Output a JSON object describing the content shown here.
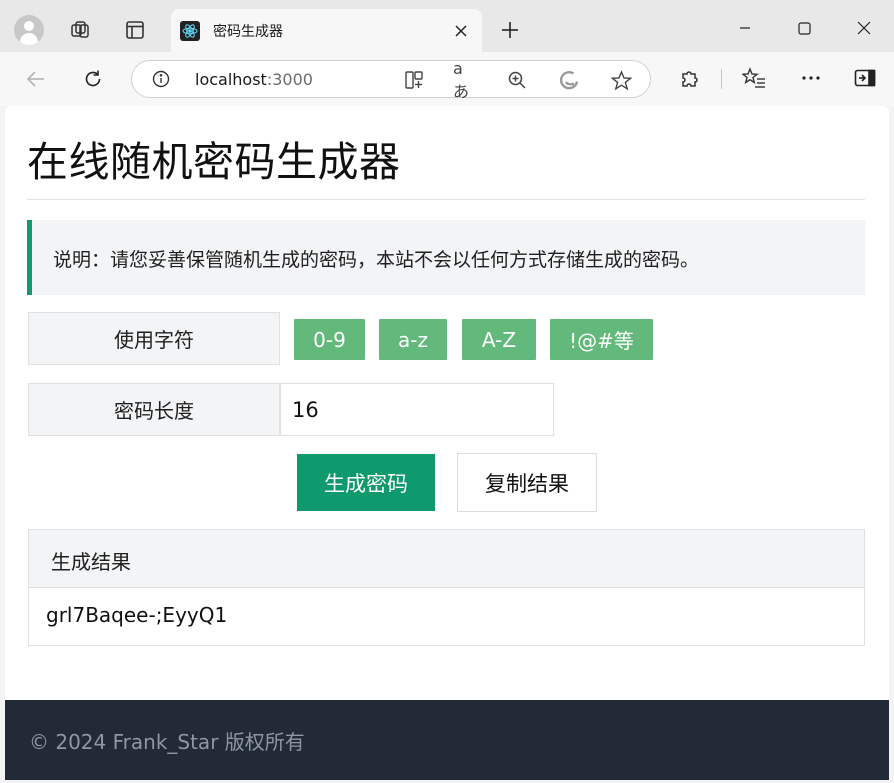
{
  "browser": {
    "tab_title": "密码生成器",
    "url_host": "localhost",
    "url_port": ":3000",
    "icons": {
      "profile": "profile-avatar-icon",
      "workspaces": "workspaces-icon",
      "vertical_tabs": "tab-actions-icon",
      "favicon": "react-logo-icon",
      "close_tab": "close-icon",
      "new_tab": "plus-icon",
      "minimize": "minimize-icon",
      "maximize": "maximize-icon",
      "close_window": "close-icon",
      "back": "back-arrow-icon",
      "refresh": "refresh-icon",
      "site_info": "info-icon",
      "split_screen": "split-screen-icon",
      "read_aloud": "read-aloud-icon",
      "zoom": "zoom-in-icon",
      "edge": "edge-logo-icon",
      "favorite": "star-icon",
      "extensions": "puzzle-icon",
      "favorites_list": "favorites-list-icon",
      "more": "more-dots-icon",
      "sidebar": "sidebar-icon"
    }
  },
  "page": {
    "title": "在线随机密码生成器",
    "notice": "说明：请您妥善保管随机生成的密码，本站不会以任何方式存储生成的密码。",
    "charset_label": "使用字符",
    "charset_options": [
      "0-9",
      "a-z",
      "A-Z",
      "!@#等"
    ],
    "length_label": "密码长度",
    "length_value": "16",
    "generate_button": "生成密码",
    "copy_button": "复制结果",
    "result_header": "生成结果",
    "result_value": "grl7Baqee-;EyyQ1",
    "footer": "© 2024 Frank_Star 版权所有"
  },
  "colors": {
    "primary": "#0e9a6c",
    "chip": "#63b97b",
    "footer_bg": "#212a36",
    "panel_bg": "#f3f4f6"
  }
}
